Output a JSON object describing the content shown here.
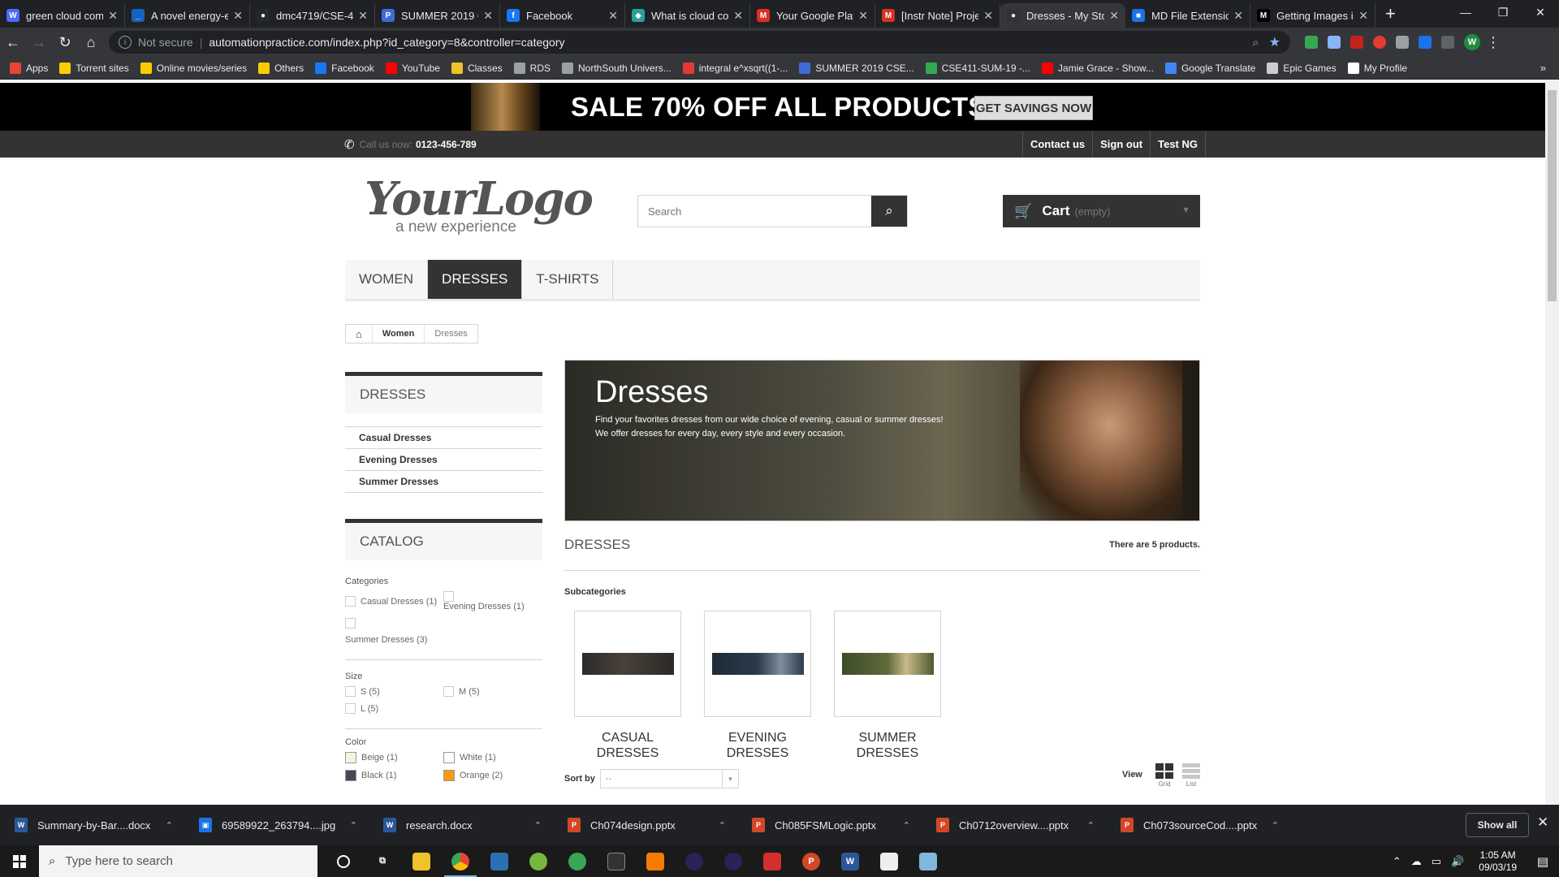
{
  "browser": {
    "tabs": [
      {
        "title": "green cloud com",
        "icon_color": "#4a6cf7",
        "icon": "W"
      },
      {
        "title": "A novel energy-e",
        "icon_color": "#1565c0",
        "icon": "_"
      },
      {
        "title": "dmc4719/CSE-4",
        "icon_color": "#24292e",
        "icon": "●"
      },
      {
        "title": "SUMMER 2019 C",
        "icon_color": "#3f6ad8",
        "icon": "P"
      },
      {
        "title": "Facebook",
        "icon_color": "#1877f2",
        "icon": "f"
      },
      {
        "title": "What is cloud co",
        "icon_color": "#2aa198",
        "icon": "◆"
      },
      {
        "title": "Your Google Play",
        "icon_color": "#d93025",
        "icon": "M"
      },
      {
        "title": "[Instr Note] Proje",
        "icon_color": "#d93025",
        "icon": "M"
      },
      {
        "title": "Dresses - My Sto",
        "icon_color": "#333333",
        "icon": "●"
      },
      {
        "title": "MD File Extensio",
        "icon_color": "#1a73e8",
        "icon": "■"
      },
      {
        "title": "Getting Images i",
        "icon_color": "#000000",
        "icon": "M"
      }
    ],
    "active_tab": 8,
    "new_tab_symbol": "+",
    "window_controls": [
      "—",
      "❐",
      "✕"
    ],
    "security_label": "Not secure",
    "url": "automationpractice.com/index.php?id_category=8&controller=category",
    "bookmarks": [
      {
        "label": "Apps",
        "color": "#ea4335"
      },
      {
        "label": "Torrent sites",
        "color": "#f9ce00"
      },
      {
        "label": "Online movies/series",
        "color": "#f9ce00"
      },
      {
        "label": "Others",
        "color": "#f9ce00"
      },
      {
        "label": "Facebook",
        "color": "#1877f2"
      },
      {
        "label": "YouTube",
        "color": "#ff0000"
      },
      {
        "label": "Classes",
        "color": "#f0c22b"
      },
      {
        "label": "RDS",
        "color": "#9aa0a6"
      },
      {
        "label": "NorthSouth Univers...",
        "color": "#9aa0a6"
      },
      {
        "label": "integral e^xsqrt((1-...",
        "color": "#e53935"
      },
      {
        "label": "SUMMER 2019 CSE...",
        "color": "#3f6ad8"
      },
      {
        "label": "CSE411-SUM-19 -...",
        "color": "#34a853"
      },
      {
        "label": "Jamie Grace - Show...",
        "color": "#ff0000"
      },
      {
        "label": "Google Translate",
        "color": "#4285f4"
      },
      {
        "label": "Epic Games",
        "color": "#cccccc"
      },
      {
        "label": "My Profile",
        "color": "#ffffff"
      }
    ],
    "bookmarks_more": "»",
    "profile_initial": "W"
  },
  "site": {
    "banner_text": "SALE 70% OFF ALL PRODUCTS",
    "banner_button": "GET SAVINGS NOW",
    "call_label": "Call us now:",
    "phone": "0123-456-789",
    "nav_links": [
      "Contact us",
      "Sign out",
      "Test NG"
    ],
    "logo_text": "YourLogo",
    "logo_tagline": "a new experience",
    "search_placeholder": "Search",
    "cart_label": "Cart",
    "cart_status": "(empty)",
    "menu": [
      "Women",
      "Dresses",
      "T-shirts"
    ],
    "menu_active": 1,
    "breadcrumb": [
      "Women",
      "Dresses"
    ]
  },
  "sidebar": {
    "dresses_title": "Dresses",
    "dresses_items": [
      "Casual Dresses",
      "Evening Dresses",
      "Summer Dresses"
    ],
    "catalog_title": "Catalog",
    "categories_title": "Categories",
    "categories": [
      "Casual Dresses (1)",
      "Evening Dresses (1)",
      "Summer Dresses (3)"
    ],
    "size_title": "Size",
    "sizes": [
      "S (5)",
      "M (5)",
      "L (5)"
    ],
    "color_title": "Color",
    "colors": [
      {
        "label": "Beige (1)",
        "hex": "#f5f5dc"
      },
      {
        "label": "White (1)",
        "hex": "#ffffff"
      },
      {
        "label": "Black (1)",
        "hex": "#434a54"
      },
      {
        "label": "Orange (2)",
        "hex": "#f39c11"
      }
    ]
  },
  "main": {
    "category_title": "Dresses",
    "category_desc_1": "Find your favorites dresses from our wide choice of evening, casual or summer dresses!",
    "category_desc_2": "We offer dresses for every day, every style and every occasion.",
    "heading": "Dresses",
    "product_count": "There are 5 products.",
    "subcategories_title": "Subcategories",
    "subcategories": [
      {
        "name_line1": "Casual",
        "name_line2": "Dresses"
      },
      {
        "name_line1": "Evening",
        "name_line2": "Dresses"
      },
      {
        "name_line1": "Summer",
        "name_line2": "Dresses"
      }
    ],
    "sort_label": "Sort by",
    "sort_value": "--",
    "view_label": "View",
    "view_grid": "Grid",
    "view_list": "List"
  },
  "downloads": {
    "items": [
      {
        "name": "Summary-by-Bar....docx",
        "type": "word"
      },
      {
        "name": "69589922_263794....jpg",
        "type": "image"
      },
      {
        "name": "research.docx",
        "type": "word"
      },
      {
        "name": "Ch074design.pptx",
        "type": "ppt"
      },
      {
        "name": "Ch085FSMLogic.pptx",
        "type": "ppt"
      },
      {
        "name": "Ch0712overview....pptx",
        "type": "ppt"
      },
      {
        "name": "Ch073sourceCod....pptx",
        "type": "ppt"
      }
    ],
    "show_all": "Show all"
  },
  "taskbar": {
    "search_placeholder": "Type here to search",
    "time": "1:05 AM",
    "date": "09/03/19"
  }
}
